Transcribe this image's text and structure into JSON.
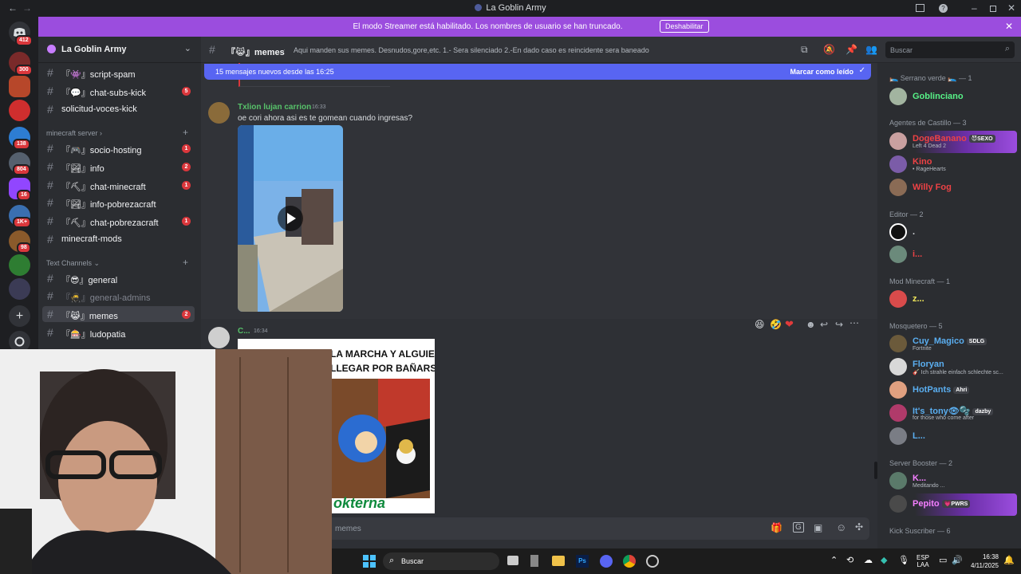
{
  "window": {
    "title": "La Goblin Army",
    "back": "←",
    "forward": "→"
  },
  "banner": {
    "text": "El modo Streamer está habilitado. Los nombres de usuario se han truncado.",
    "button": "Deshabilitar"
  },
  "rail": {
    "badges": [
      "412",
      "300",
      "138",
      "804",
      "16",
      "1K+",
      "98"
    ]
  },
  "guild": {
    "name": "La Goblin Army"
  },
  "channels": [
    {
      "name": "『👾』script-spam",
      "count": ""
    },
    {
      "name": "『💬』chat-subs-kick",
      "count": "5"
    },
    {
      "name": "solicitud-voces-kick",
      "count": ""
    },
    {
      "name": "『🎮』socio-hosting",
      "count": "1"
    },
    {
      "name": "『🏞』info",
      "count": "2"
    },
    {
      "name": "『⛏』chat-minecraft",
      "count": "1"
    },
    {
      "name": "『🏞』info-pobrezacraft",
      "count": ""
    },
    {
      "name": "『⛏』chat-pobrezacraft",
      "count": "1"
    },
    {
      "name": "minecraft-mods",
      "count": ""
    },
    {
      "name": "『😎』general",
      "count": ""
    },
    {
      "name": "『🥷』general-admins",
      "count": ""
    },
    {
      "name": "『😹』memes",
      "count": "2"
    },
    {
      "name": "『🎰』ludopatia",
      "count": ""
    }
  ],
  "categories": {
    "minecraft": "minecraft server",
    "text": "Text Channels"
  },
  "header": {
    "channel": "『😹』memes",
    "topic": "Aqui manden sus memes. Desnudos,gore,etc. 1.- Sera silenciado 2.-En dado caso es reincidente sera baneado",
    "search_placeholder": "Buscar"
  },
  "newbar": {
    "text": "15 mensajes nuevos desde las 16:25",
    "action": "Marcar como leído"
  },
  "messages": [
    {
      "author": "Txlion lujan carrion",
      "time": "16:33",
      "text": "oe cori ahora asi es te gomean cuando ingresas?"
    },
    {
      "author": "C...",
      "time": "16:34",
      "text": ""
    }
  ],
  "meme": {
    "line1": "LA MARCHA Y ALGUIEN",
    "line2": "LLEGAR POR BAÑARSE",
    "footer": "okterna"
  },
  "reactions": [
    "😆",
    "🤣",
    "❤"
  ],
  "composer": {
    "placeholder": "memes"
  },
  "members": {
    "groups": [
      {
        "title": "🛌 Serrano verde 🛌 — 1",
        "members": [
          {
            "name": "Goblinciano",
            "color": "#57f287",
            "sub": "",
            "tag": ""
          }
        ]
      },
      {
        "title": "Agentes de Castillo — 3",
        "members": [
          {
            "name": "DogeBanano",
            "color": "#ed4245",
            "sub": "Left 4 Dead 2",
            "tag": "😈SEXO"
          },
          {
            "name": "Kino",
            "color": "#ed4245",
            "sub": "• RageHearts",
            "tag": ""
          },
          {
            "name": "Willy Fog",
            "color": "#ed4245",
            "sub": "",
            "tag": ""
          }
        ]
      },
      {
        "title": "Editor — 2",
        "members": [
          {
            "name": ".",
            "color": "#dbdee1",
            "sub": "",
            "tag": ""
          },
          {
            "name": "i...",
            "color": "#ed4245",
            "sub": "",
            "tag": ""
          }
        ]
      },
      {
        "title": "Mod Minecraft — 1",
        "members": [
          {
            "name": "z...",
            "color": "#f0e65a",
            "sub": "",
            "tag": ""
          }
        ]
      },
      {
        "title": "Mosquetero — 5",
        "members": [
          {
            "name": "Cuy_Magico",
            "color": "#5aaef0",
            "sub": "Fortnite",
            "tag": "SDLG"
          },
          {
            "name": "Floryan",
            "color": "#5aaef0",
            "sub": "🎸 Ich strahle einfach schlechte sc...",
            "tag": ""
          },
          {
            "name": "HotPants",
            "color": "#5aaef0",
            "sub": "",
            "tag": "Ahri"
          },
          {
            "name": "It's_tony👁🫧",
            "color": "#5aaef0",
            "sub": "for those who come after",
            "tag": "dazby"
          },
          {
            "name": "L...",
            "color": "#5aaef0",
            "sub": "",
            "tag": ""
          }
        ]
      },
      {
        "title": "Server Booster — 2",
        "members": [
          {
            "name": "K...",
            "color": "#f47fff",
            "sub": "Meditando ...",
            "tag": ""
          },
          {
            "name": "Pepito",
            "color": "#f47fff",
            "sub": "",
            "tag": "💗PWRS"
          }
        ]
      },
      {
        "title": "Kick Suscriber — 6",
        "members": []
      }
    ]
  },
  "taskbar": {
    "search": "Buscar",
    "lang1": "ESP",
    "lang2": "LAA",
    "time": "16:38",
    "date": "4/11/2025"
  }
}
